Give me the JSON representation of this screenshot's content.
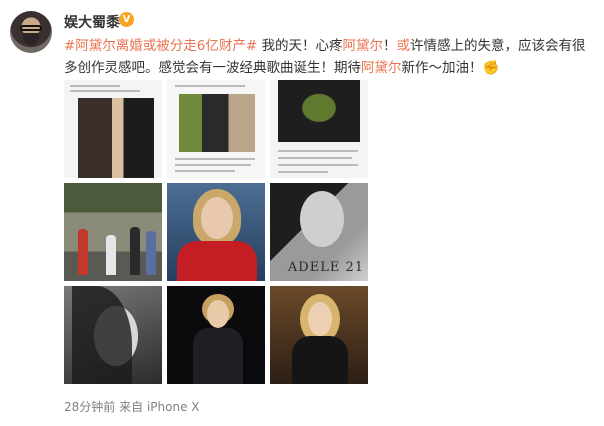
{
  "user": {
    "name": "娱大蜀黍",
    "verified_badge": "V"
  },
  "post": {
    "hashtag": "#阿黛尔离婚或被分走6亿财产#",
    "text_1": " 我的天！心疼",
    "mention_1": "阿黛尔",
    "text_2": "！",
    "mention_2": "或",
    "text_3": "许情感上的失意，应该会有很多创作灵感吧。感觉会有一波经典歌曲诞生！期待",
    "mention_3": "阿黛尔",
    "text_4": "新作～加油！",
    "emoji": "✊"
  },
  "images": {
    "album_text": "ADELE 21"
  },
  "footer": {
    "time": "28分钟前",
    "source_prefix": "来自",
    "source": "iPhone X"
  }
}
